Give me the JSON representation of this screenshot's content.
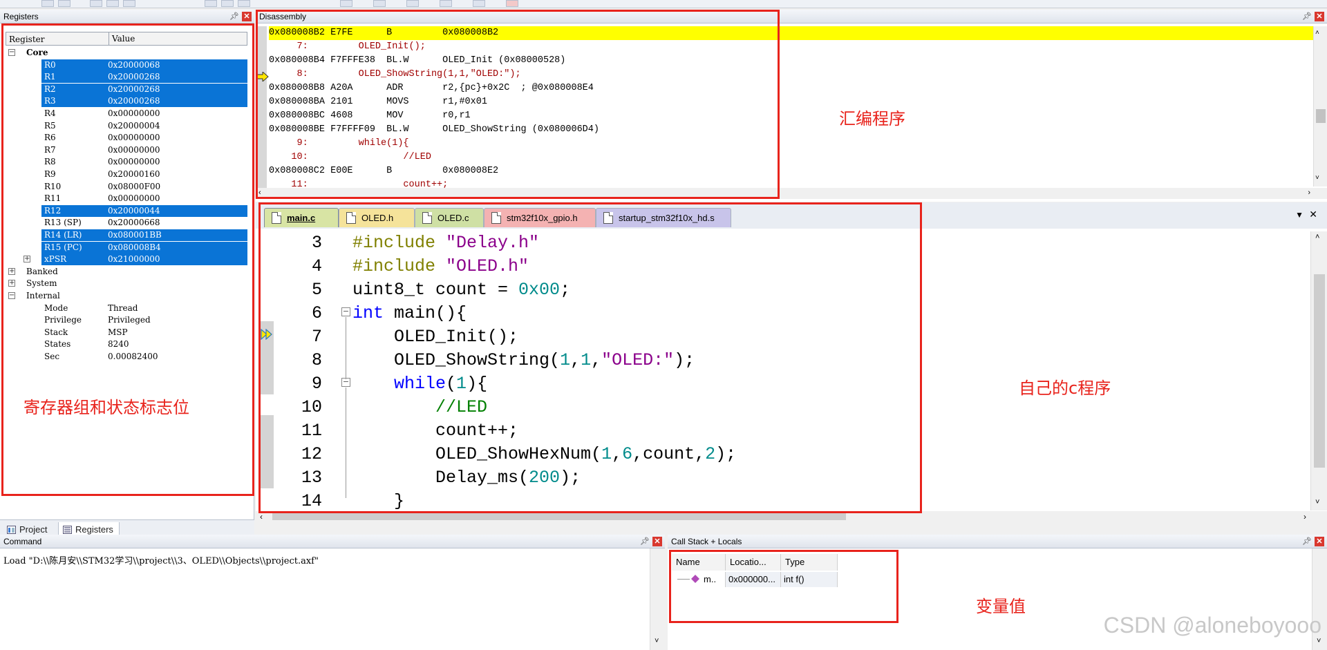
{
  "registers": {
    "title": "Registers",
    "col_register": "Register",
    "col_value": "Value",
    "groups": {
      "core": "Core",
      "banked": "Banked",
      "system": "System",
      "internal": "Internal"
    },
    "core": [
      {
        "name": "R0",
        "value": "0x20000068",
        "selected": true
      },
      {
        "name": "R1",
        "value": "0x20000268",
        "selected": true
      },
      {
        "name": "R2",
        "value": "0x20000268",
        "selected": true
      },
      {
        "name": "R3",
        "value": "0x20000268",
        "selected": true
      },
      {
        "name": "R4",
        "value": "0x00000000",
        "selected": false
      },
      {
        "name": "R5",
        "value": "0x20000004",
        "selected": false
      },
      {
        "name": "R6",
        "value": "0x00000000",
        "selected": false
      },
      {
        "name": "R7",
        "value": "0x00000000",
        "selected": false
      },
      {
        "name": "R8",
        "value": "0x00000000",
        "selected": false
      },
      {
        "name": "R9",
        "value": "0x20000160",
        "selected": false
      },
      {
        "name": "R10",
        "value": "0x08000F00",
        "selected": false
      },
      {
        "name": "R11",
        "value": "0x00000000",
        "selected": false
      },
      {
        "name": "R12",
        "value": "0x20000044",
        "selected": true
      },
      {
        "name": "R13 (SP)",
        "value": "0x20000668",
        "selected": false
      },
      {
        "name": "R14 (LR)",
        "value": "0x080001BB",
        "selected": true
      },
      {
        "name": "R15 (PC)",
        "value": "0x080008B4",
        "selected": true
      },
      {
        "name": "xPSR",
        "value": "0x21000000",
        "selected": true
      }
    ],
    "internal": [
      {
        "name": "Mode",
        "value": "Thread"
      },
      {
        "name": "Privilege",
        "value": "Privileged"
      },
      {
        "name": "Stack",
        "value": "MSP"
      },
      {
        "name": "States",
        "value": "8240"
      },
      {
        "name": "Sec",
        "value": "0.00082400"
      }
    ],
    "tab_project": "Project",
    "tab_registers": "Registers"
  },
  "disassembly": {
    "title": "Disassembly",
    "lines": [
      {
        "text": "0x080008B2 E7FE      B         0x080008B2",
        "kind": "hl"
      },
      {
        "text": "     7:         OLED_Init();",
        "kind": "src"
      },
      {
        "text": "0x080008B4 F7FFFE38  BL.W      OLED_Init (0x08000528)",
        "kind": "asm"
      },
      {
        "text": "     8:         OLED_ShowString(1,1,\"OLED:\");",
        "kind": "src"
      },
      {
        "text": "0x080008B8 A20A      ADR       r2,{pc}+0x2C  ; @0x080008E4",
        "kind": "asm"
      },
      {
        "text": "0x080008BA 2101      MOVS      r1,#0x01",
        "kind": "asm"
      },
      {
        "text": "0x080008BC 4608      MOV       r0,r1",
        "kind": "asm"
      },
      {
        "text": "0x080008BE F7FFFF09  BL.W      OLED_ShowString (0x080006D4)",
        "kind": "asm"
      },
      {
        "text": "     9:         while(1){",
        "kind": "src"
      },
      {
        "text": "    10:                 //LED",
        "kind": "src"
      },
      {
        "text": "0x080008C2 E00E      B         0x080008E2",
        "kind": "asm"
      },
      {
        "text": "    11:                 count++;",
        "kind": "src"
      }
    ]
  },
  "editor": {
    "tabs": [
      {
        "label": "main.c",
        "color": "#d8e4a4",
        "active": true
      },
      {
        "label": "OLED.h",
        "color": "#f5e39a",
        "active": false
      },
      {
        "label": "OLED.c",
        "color": "#cfe0a4",
        "active": false
      },
      {
        "label": "stm32f10x_gpio.h",
        "color": "#f4b2b2",
        "active": false
      },
      {
        "label": "startup_stm32f10x_hd.s",
        "color": "#c8c4ea",
        "active": false
      }
    ],
    "lines": [
      {
        "num": "3"
      },
      {
        "num": "4"
      },
      {
        "num": "5"
      },
      {
        "num": "6"
      },
      {
        "num": "7"
      },
      {
        "num": "8"
      },
      {
        "num": "9"
      },
      {
        "num": "10"
      },
      {
        "num": "11"
      },
      {
        "num": "12"
      },
      {
        "num": "13"
      },
      {
        "num": "14"
      }
    ],
    "code": {
      "l3_a": "#include ",
      "l3_b": "\"Delay.h\"",
      "l4_a": "#include ",
      "l4_b": "\"OLED.h\"",
      "l5_a": "uint8_t count = ",
      "l5_b": "0x00",
      "l5_c": ";",
      "l6_a": "int",
      "l6_b": " main(){",
      "l7": "    OLED_Init();",
      "l8_a": "    OLED_ShowString(",
      "l8_b": "1",
      "l8_c": ",",
      "l8_d": "1",
      "l8_e": ",",
      "l8_f": "\"OLED:\"",
      "l8_g": ");",
      "l9_a": "    ",
      "l9_b": "while",
      "l9_c": "(",
      "l9_d": "1",
      "l9_e": "){",
      "l10": "        //LED",
      "l11": "        count++;",
      "l12_a": "        OLED_ShowHexNum(",
      "l12_b": "1",
      "l12_c": ",",
      "l12_d": "6",
      "l12_e": ",count,",
      "l12_f": "2",
      "l12_g": ");",
      "l13_a": "        Delay_ms(",
      "l13_b": "200",
      "l13_c": ");",
      "l14": "    }"
    }
  },
  "command": {
    "title": "Command",
    "text": "Load \"D:\\\\陈月安\\\\STM32学习\\\\project\\\\3、OLED\\\\Objects\\\\project.axf\""
  },
  "callstack": {
    "title": "Call Stack + Locals",
    "col_name": "Name",
    "col_location": "Locatio...",
    "col_type": "Type",
    "row": {
      "name": "m..",
      "location": "0x000000...",
      "type": "int f()"
    }
  },
  "annotations": {
    "registers": "寄存器组和状态标志位",
    "disassembly": "汇编程序",
    "code": "自己的c程序",
    "vars": "变量值"
  },
  "watermark": "CSDN @aloneboyooo",
  "colors": {
    "selection": "#0a74d6",
    "highlight": "#ffff00",
    "annotation": "#e8231c"
  }
}
